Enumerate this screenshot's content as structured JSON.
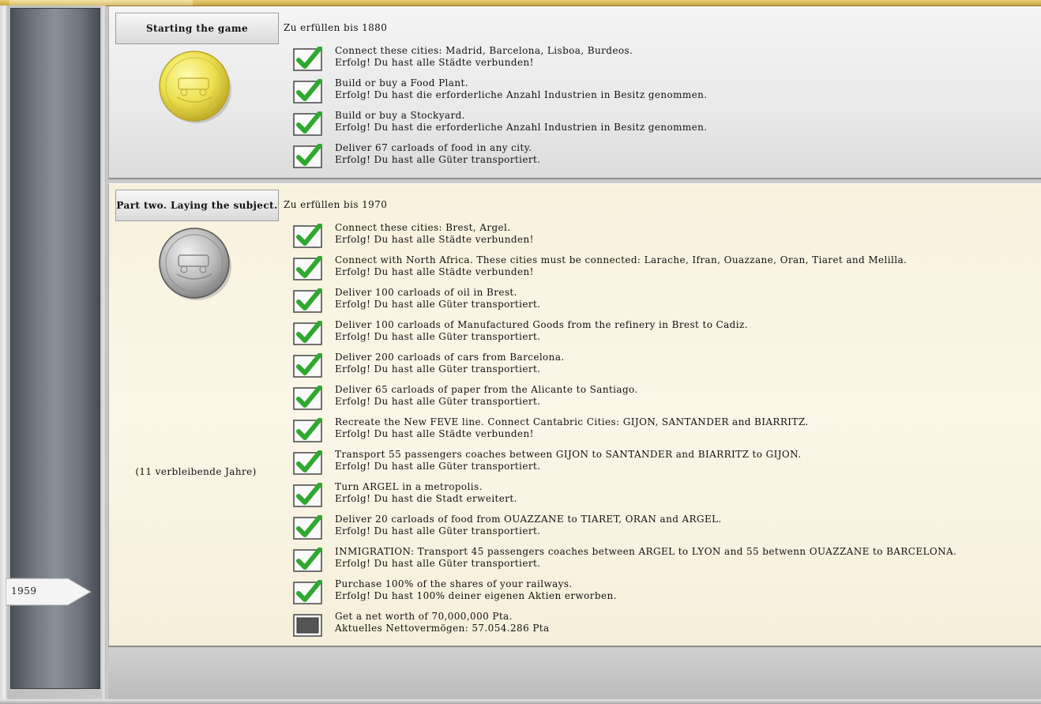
{
  "timeline": {
    "current_year": "1959"
  },
  "phases": [
    {
      "title": "Starting the game",
      "deadline": "Zu erfüllen bis 1880",
      "medal": "gold-medal-icon",
      "remaining": "",
      "objectives": [
        {
          "text": "Connect these cities: Madrid, Barcelona, Lisboa, Burdeos.",
          "status": "Erfolg! Du hast alle Städte verbunden!",
          "done": true
        },
        {
          "text": "Build or buy a Food Plant.",
          "status": "Erfolg! Du hast die erforderliche Anzahl Industrien in Besitz genommen.",
          "done": true
        },
        {
          "text": "Build or buy a  Stockyard.",
          "status": "Erfolg! Du hast die erforderliche Anzahl Industrien in Besitz genommen.",
          "done": true
        },
        {
          "text": "Deliver 67 carloads of food in any city.",
          "status": "Erfolg! Du hast alle Güter transportiert.",
          "done": true
        }
      ]
    },
    {
      "title": "Part two. Laying the subject.",
      "deadline": "Zu erfüllen bis 1970",
      "medal": "silver-medal-icon",
      "remaining": "(11 verbleibende Jahre)",
      "objectives": [
        {
          "text": "Connect these cities: Brest, Argel.",
          "status": "Erfolg! Du hast alle Städte verbunden!",
          "done": true
        },
        {
          "text": "Connect with North Africa. These cities must be connected: Larache, Ifran, Ouazzane, Oran, Tiaret and Melilla.",
          "status": "Erfolg! Du hast alle Städte verbunden!",
          "done": true
        },
        {
          "text": "Deliver 100 carloads of oil in Brest.",
          "status": "Erfolg! Du hast alle Güter transportiert.",
          "done": true
        },
        {
          "text": "Deliver 100 carloads of Manufactured Goods from the refinery in Brest to Cadiz.",
          "status": "Erfolg! Du hast alle Güter transportiert.",
          "done": true
        },
        {
          "text": "Deliver 200 carloads of cars from Barcelona.",
          "status": "Erfolg! Du hast alle Güter transportiert.",
          "done": true
        },
        {
          "text": "Deliver 65 carloads of paper from the Alicante to Santiago.",
          "status": "Erfolg! Du hast alle Güter transportiert.",
          "done": true
        },
        {
          "text": "Recreate the New FEVE line. Connect Cantabric Cities: GIJON, SANTANDER and BIARRITZ.",
          "status": "Erfolg! Du hast alle Städte verbunden!",
          "done": true
        },
        {
          "text": "Transport 55 passengers coaches between GIJON to SANTANDER and BIARRITZ to GIJON.",
          "status": "Erfolg! Du hast alle Güter transportiert.",
          "done": true
        },
        {
          "text": "Turn ARGEL in a metropolis.",
          "status": "Erfolg! Du hast die Stadt erweitert.",
          "done": true
        },
        {
          "text": "Deliver 20 carloads of food from OUAZZANE to TIARET, ORAN and ARGEL.",
          "status": "Erfolg! Du hast alle Güter transportiert.",
          "done": true
        },
        {
          "text": "INMIGRATION: Transport 45 passengers coaches between ARGEL to LYON and 55 betwenn OUAZZANE to BARCELONA.",
          "status": "Erfolg! Du hast alle Güter transportiert.",
          "done": true
        },
        {
          "text": "Purchase 100% of the shares of your railways.",
          "status": "Erfolg! Du hast 100% deiner eigenen Aktien erworben.",
          "done": true
        },
        {
          "text": "Get a net worth of 70,000,000 Pta.",
          "status": "Aktuelles Nettovermögen: 57.054.286 Pta",
          "done": false
        }
      ]
    }
  ],
  "colors": {
    "check_green": "#2fa82f",
    "gold": "#e8d84a",
    "silver": "#b9b9b9",
    "panel_cream": "#fbf6e8"
  }
}
